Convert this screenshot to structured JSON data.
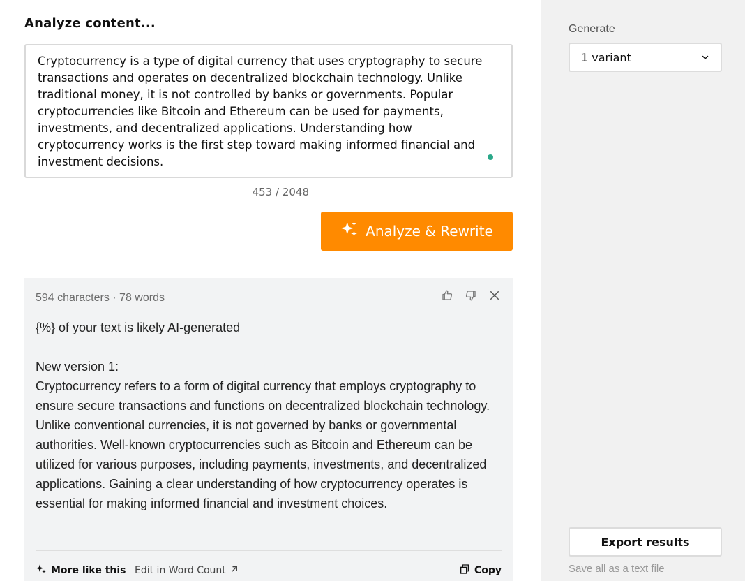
{
  "main": {
    "section_title": "Analyze content...",
    "input_text": "Cryptocurrency is a type of digital currency that uses cryptography to secure transactions and operates on decentralized blockchain technology. Unlike traditional money, it is not controlled by banks or governments. Popular cryptocurrencies like Bitcoin and Ethereum can be used for payments, investments, and decentralized applications. Understanding how cryptocurrency works is the first step toward making informed financial and investment decisions.",
    "char_counter": "453 / 2048",
    "analyze_button_label": "Analyze & Rewrite"
  },
  "result": {
    "meta": "594 characters · 78 words",
    "ai_line": "{%} of your text is likely AI-generated",
    "version_heading": "New version 1:",
    "version_text": "Cryptocurrency refers to a form of digital currency that employs cryptography to ensure secure transactions and functions on decentralized blockchain technology. Unlike conventional currencies, it is not governed by banks or governmental authorities. Well-known cryptocurrencies such as Bitcoin and Ethereum can be utilized for various purposes, including payments, investments, and decentralized applications. Gaining a clear understanding of how cryptocurrency operates is essential for making informed financial and investment choices.",
    "more_like_this": "More like this",
    "edit_in": "Edit in Word Count",
    "copy": "Copy"
  },
  "sidebar": {
    "generate_label": "Generate",
    "variant_selected": "1 variant",
    "export_button": "Export results",
    "save_all": "Save all as a text file"
  },
  "colors": {
    "accent": "#ff8a00",
    "result_bg": "#f2f3f4",
    "sidebar_bg": "#f1f1f1",
    "grammar_dot": "#2aa889"
  },
  "icons": [
    "sparkle-icon",
    "thumbs-up-icon",
    "thumbs-down-icon",
    "close-icon",
    "external-arrow-icon",
    "copy-icon",
    "chevron-down-icon"
  ]
}
